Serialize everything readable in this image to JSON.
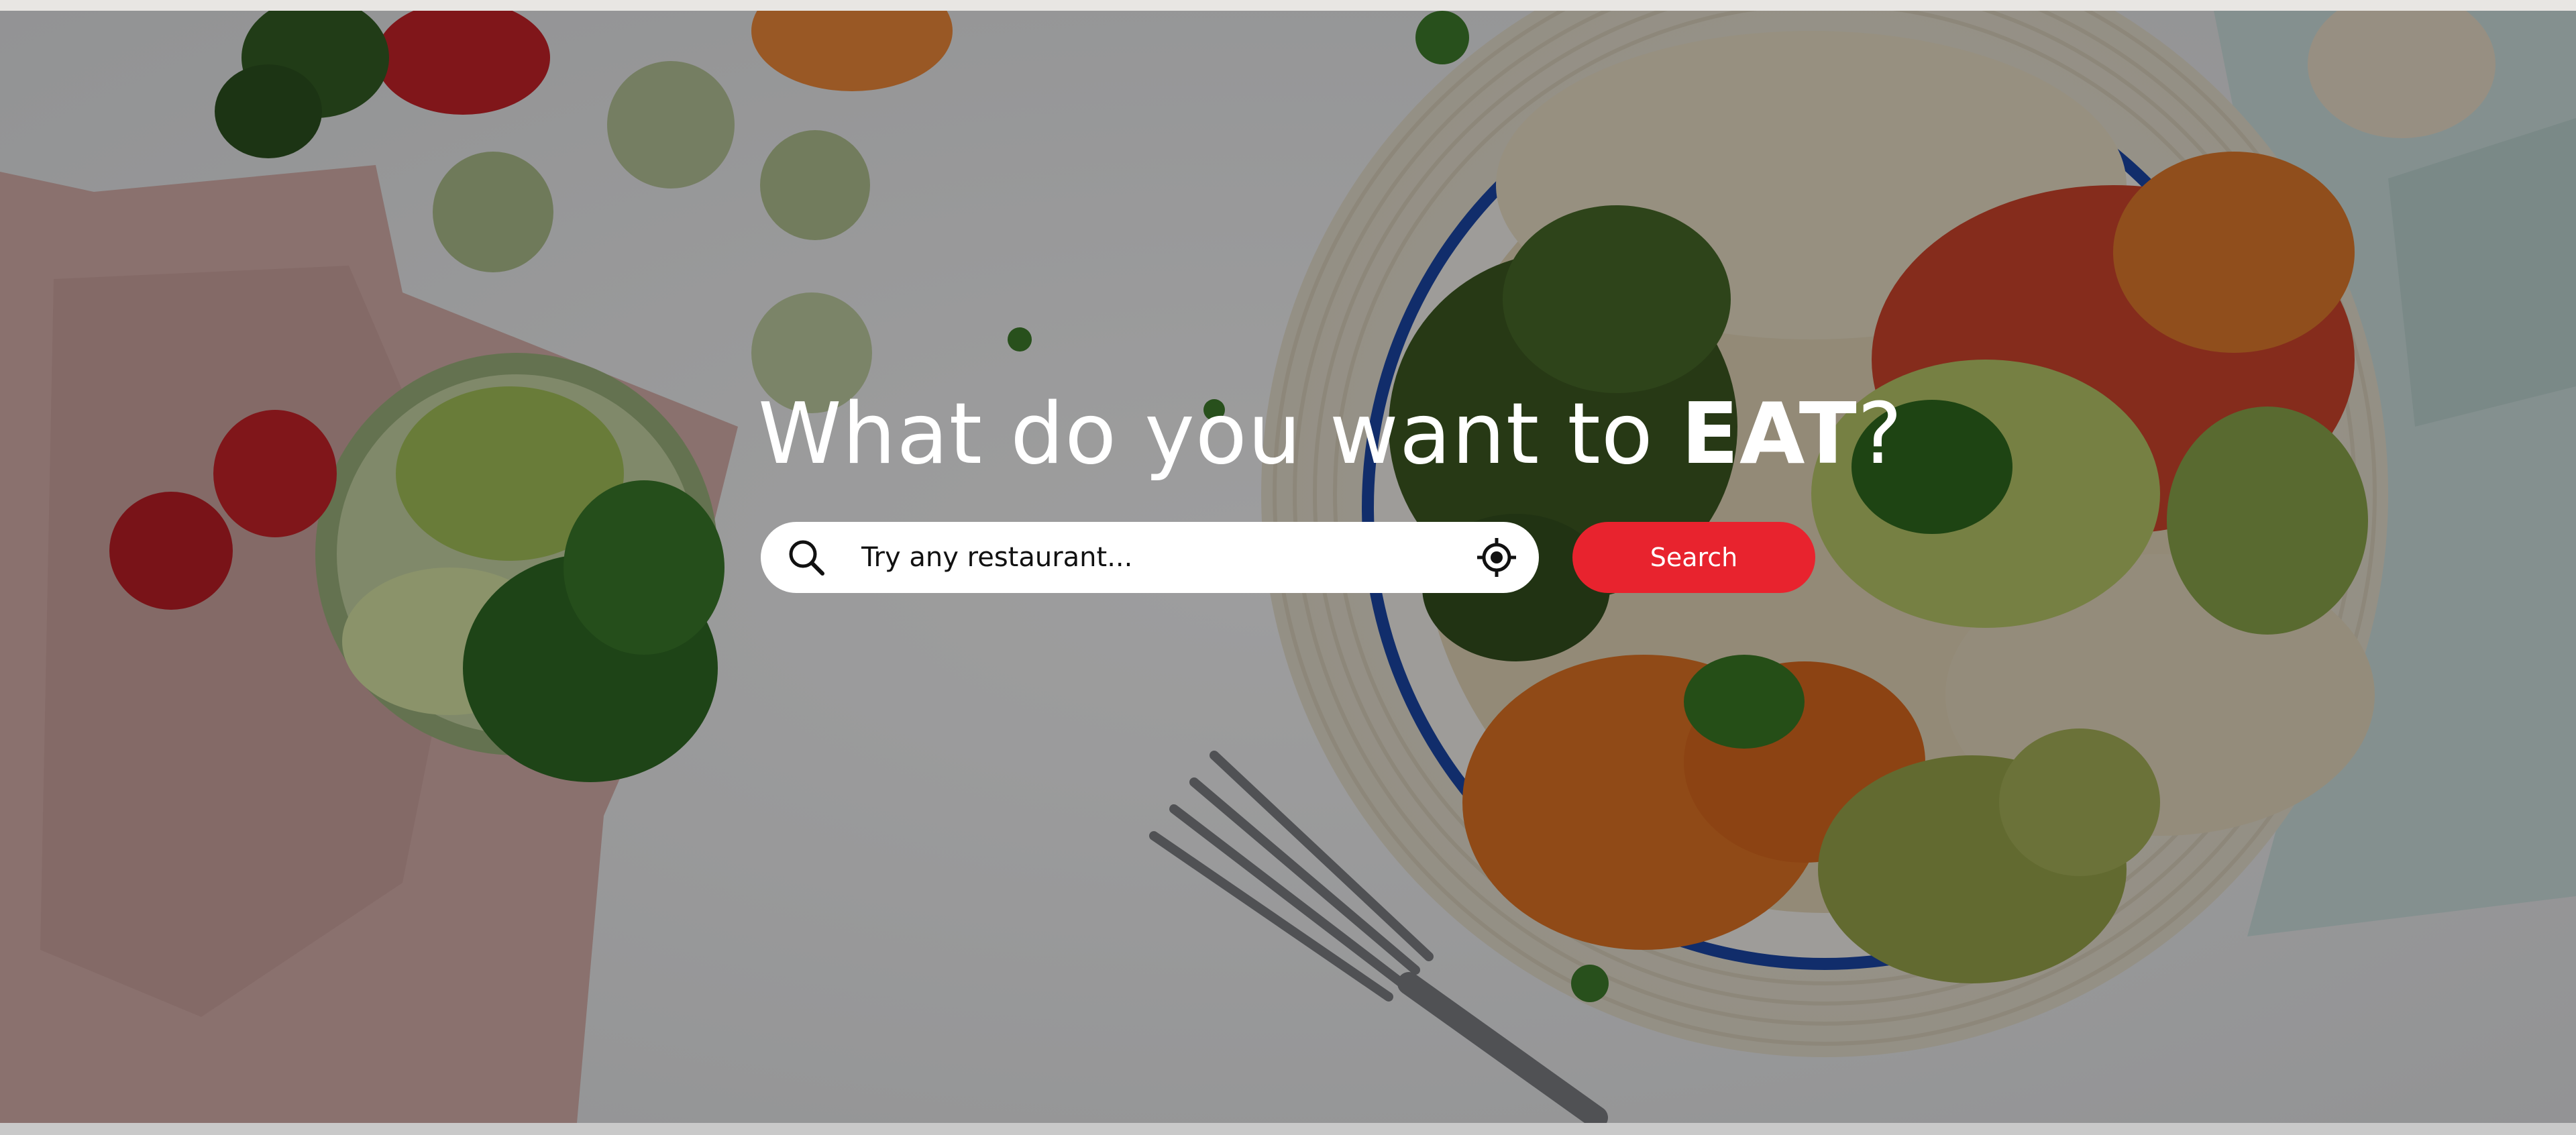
{
  "hero": {
    "title_prefix": "What do you want to ",
    "title_emphasis": "EAT",
    "title_suffix": "?"
  },
  "search": {
    "placeholder": "Try any restaurant...",
    "value": "",
    "button_label": "Search"
  },
  "icons": {
    "search": "search-icon",
    "locate": "crosshair-location-icon"
  },
  "colors": {
    "accent": "#e8232e",
    "title_text": "#ffffff",
    "input_background": "#ffffff"
  }
}
